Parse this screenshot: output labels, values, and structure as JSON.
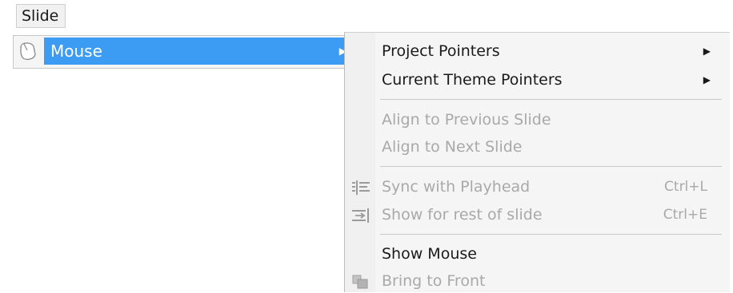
{
  "menubar": {
    "slide_label": "Slide"
  },
  "first_menu": {
    "mouse_label": "Mouse",
    "mouse_icon": "mouse-pointer-icon",
    "arrow_icon": "submenu-arrow-icon"
  },
  "submenu": {
    "items": [
      {
        "label": "Project Pointers",
        "enabled": true,
        "has_submenu": true,
        "arrow": "▶"
      },
      {
        "label": "Current Theme Pointers",
        "enabled": true,
        "has_submenu": true,
        "arrow": "▶"
      },
      {
        "label": "Align to Previous Slide",
        "enabled": false
      },
      {
        "label": "Align to Next Slide",
        "enabled": false
      },
      {
        "label": "Sync with Playhead",
        "enabled": false,
        "shortcut": "Ctrl+L",
        "icon": "sync-playhead-icon"
      },
      {
        "label": "Show for rest of slide",
        "enabled": false,
        "shortcut": "Ctrl+E",
        "icon": "show-rest-of-slide-icon"
      },
      {
        "label": "Show Mouse",
        "enabled": true
      },
      {
        "label": "Bring to Front",
        "enabled": false,
        "icon": "bring-to-front-icon"
      }
    ]
  },
  "colors": {
    "highlight": "#3c9bf2",
    "disabled_text": "#a9a9a9",
    "menu_bg": "#f5f5f5"
  }
}
